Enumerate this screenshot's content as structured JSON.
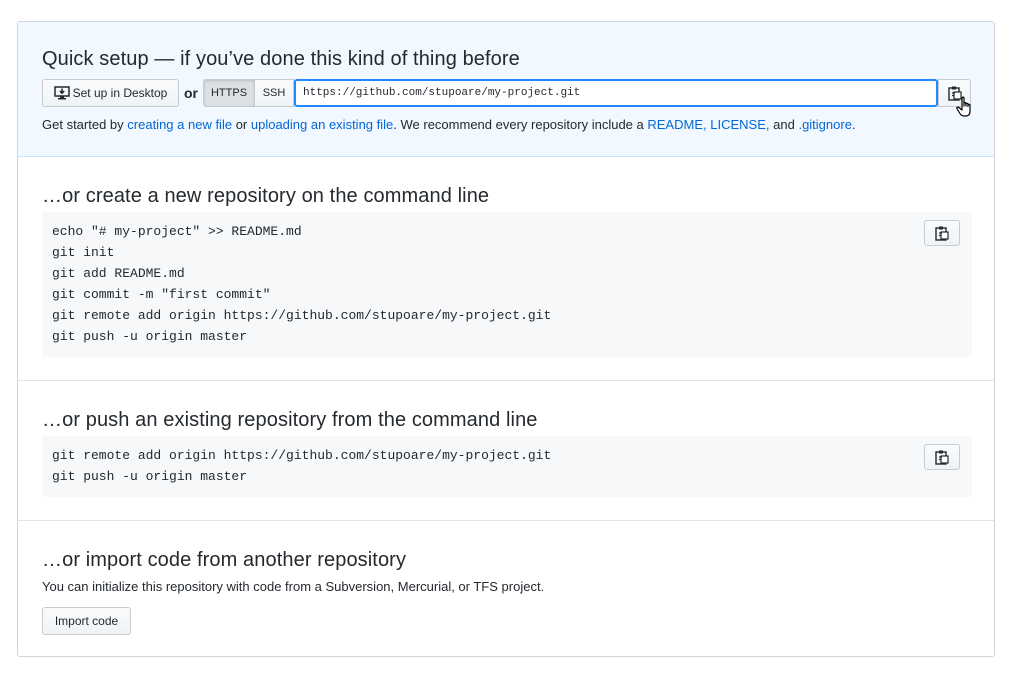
{
  "quick_setup": {
    "title": "Quick setup — if you’ve done this kind of thing before",
    "desktop_button_label": "Set up in Desktop",
    "or_label": "or",
    "protocols": [
      {
        "label": "HTTPS",
        "selected": true
      },
      {
        "label": "SSH",
        "selected": false
      }
    ],
    "url": "https://github.com/stupoare/my-project.git",
    "hint": {
      "prefix": "Get started by",
      "link1": "creating a new file",
      "mid1": "or",
      "link2": "uploading an existing file",
      "mid2": ". We recommend every repository include a",
      "link3": "README",
      "sep1": ",",
      "link4": "LICENSE,",
      "mid3": "and",
      "link5": ".gitignore",
      "suffix": "."
    }
  },
  "new_repo": {
    "title": "…or create a new repository on the command line",
    "lines": [
      "echo \"# my-project\" >> README.md",
      "git init",
      "git add README.md",
      "git commit -m \"first commit\"",
      "git remote add origin https://github.com/stupoare/my-project.git",
      "git push -u origin master"
    ]
  },
  "push_repo": {
    "title": "…or push an existing repository from the command line",
    "lines": [
      "git remote add origin https://github.com/stupoare/my-project.git",
      "git push -u origin master"
    ]
  },
  "import_repo": {
    "title": "…or import code from another repository",
    "description": "You can initialize this repository with code from a Subversion, Mercurial, or TFS project.",
    "button_label": "Import code"
  },
  "colors": {
    "link": "#0366d6",
    "quick_setup_bg": "#f1f8ff",
    "code_bg": "#f6f8fa",
    "focus_border": "#2188ff"
  },
  "icons": {
    "desktop": "desktop-download-icon",
    "clipboard": "clipboard-icon",
    "cursor": "hand-pointer-cursor"
  }
}
